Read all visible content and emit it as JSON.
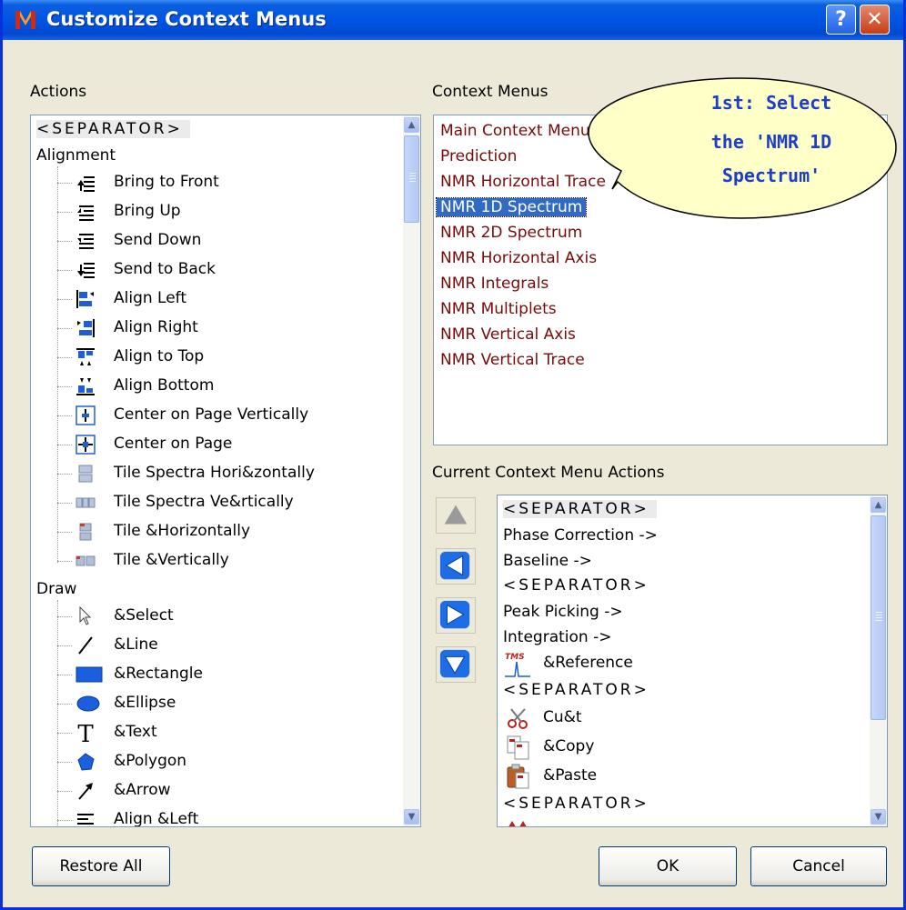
{
  "window": {
    "title": "Customize Context Menus",
    "help_glyph": "?",
    "close_glyph": "✕"
  },
  "actions": {
    "label": "Actions",
    "separator": "<SEPARATOR>",
    "groups": [
      {
        "name": "Alignment",
        "items": [
          "Bring to Front",
          "Bring Up",
          "Send Down",
          "Send to Back",
          "Align Left",
          "Align Right",
          "Align to Top",
          "Align Bottom",
          "Center on Page Vertically",
          "Center on Page",
          "Tile Spectra Hori&zontally",
          "Tile Spectra Ve&rtically",
          "Tile &Horizontally",
          "Tile &Vertically"
        ]
      },
      {
        "name": "Draw",
        "items": [
          "&Select",
          "&Line",
          "&Rectangle",
          "&Ellipse",
          "&Text",
          "&Polygon",
          "&Arrow",
          "Align &Left"
        ]
      }
    ]
  },
  "context_menus": {
    "label": "Context Menus",
    "items": [
      "Main Context Menu",
      "Prediction",
      "NMR Horizontal Trace",
      "NMR 1D Spectrum",
      "NMR 2D Spectrum",
      "NMR Horizontal Axis",
      "NMR Integrals",
      "NMR Multiplets",
      "NMR Vertical Axis",
      "NMR Vertical Trace"
    ],
    "selected": "NMR 1D Spectrum"
  },
  "current_actions": {
    "label": "Current Context Menu Actions",
    "items": [
      "<SEPARATOR>",
      "Phase Correction ->",
      "Baseline ->",
      "<SEPARATOR>",
      "Peak Picking ->",
      "Integration ->",
      "&Reference",
      "<SEPARATOR>",
      "Cu&t",
      "&Copy",
      "&Paste",
      "<SEPARATOR>"
    ],
    "reference_badge": "TMS"
  },
  "buttons": {
    "restore_all": "Restore All",
    "ok": "OK",
    "cancel": "Cancel"
  },
  "callout": {
    "line1": "1st: Select",
    "line2": "the 'NMR 1D",
    "line3": "Spectrum'"
  },
  "colors": {
    "context_menu_text": "#7a0a0a",
    "selection": "#316ac5",
    "title_bar": "#0054e3",
    "callout_fill": "#ffffc8",
    "callout_text": "#1f3ec8"
  }
}
